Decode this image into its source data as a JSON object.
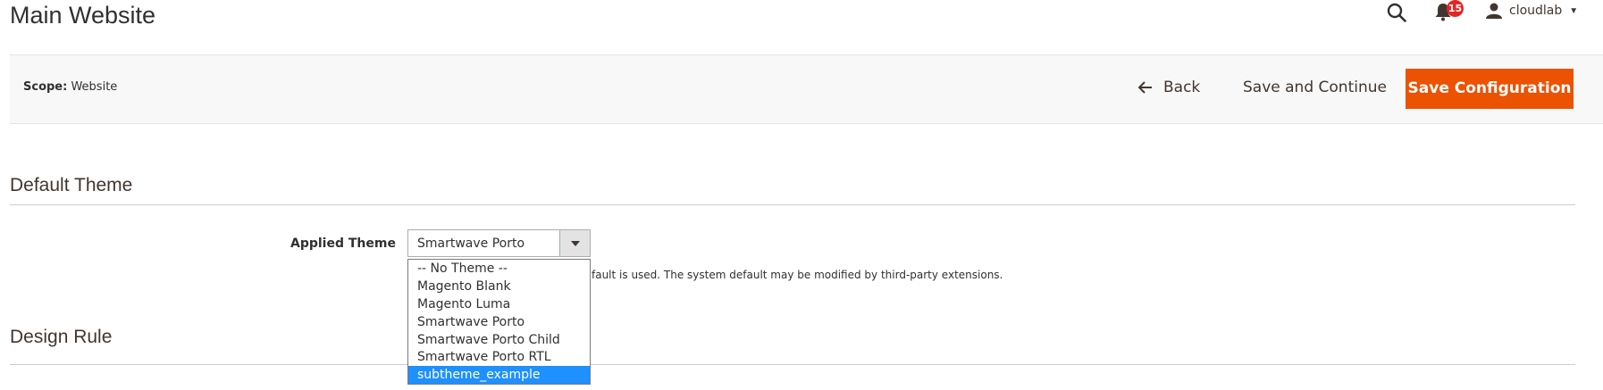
{
  "page": {
    "title": "Main Website"
  },
  "header": {
    "notifications_count": "15",
    "user_name": "cloudlab"
  },
  "toolbar": {
    "scope_label": "Scope:",
    "scope_value": "Website",
    "back_label": "Back",
    "save_continue_label": "Save and Continue",
    "save_config_label": "Save Configuration",
    "accent_color": "#eb5202"
  },
  "sections": {
    "default_theme": {
      "title": "Default Theme"
    },
    "design_rule": {
      "title": "Design Rule"
    }
  },
  "applied_theme": {
    "label": "Applied Theme",
    "selected_value": "Smartwave Porto",
    "note": "fault is used. The system default may be modified by third-party extensions.",
    "options": [
      "-- No Theme --",
      "Magento Blank",
      "Magento Luma",
      "Smartwave Porto",
      "Smartwave Porto Child",
      "Smartwave Porto RTL",
      "subtheme_example"
    ],
    "highlighted_option": "subtheme_example"
  },
  "icons": [
    "search-icon",
    "bell-icon",
    "user-icon",
    "chevron-down-icon",
    "arrow-left-icon"
  ]
}
